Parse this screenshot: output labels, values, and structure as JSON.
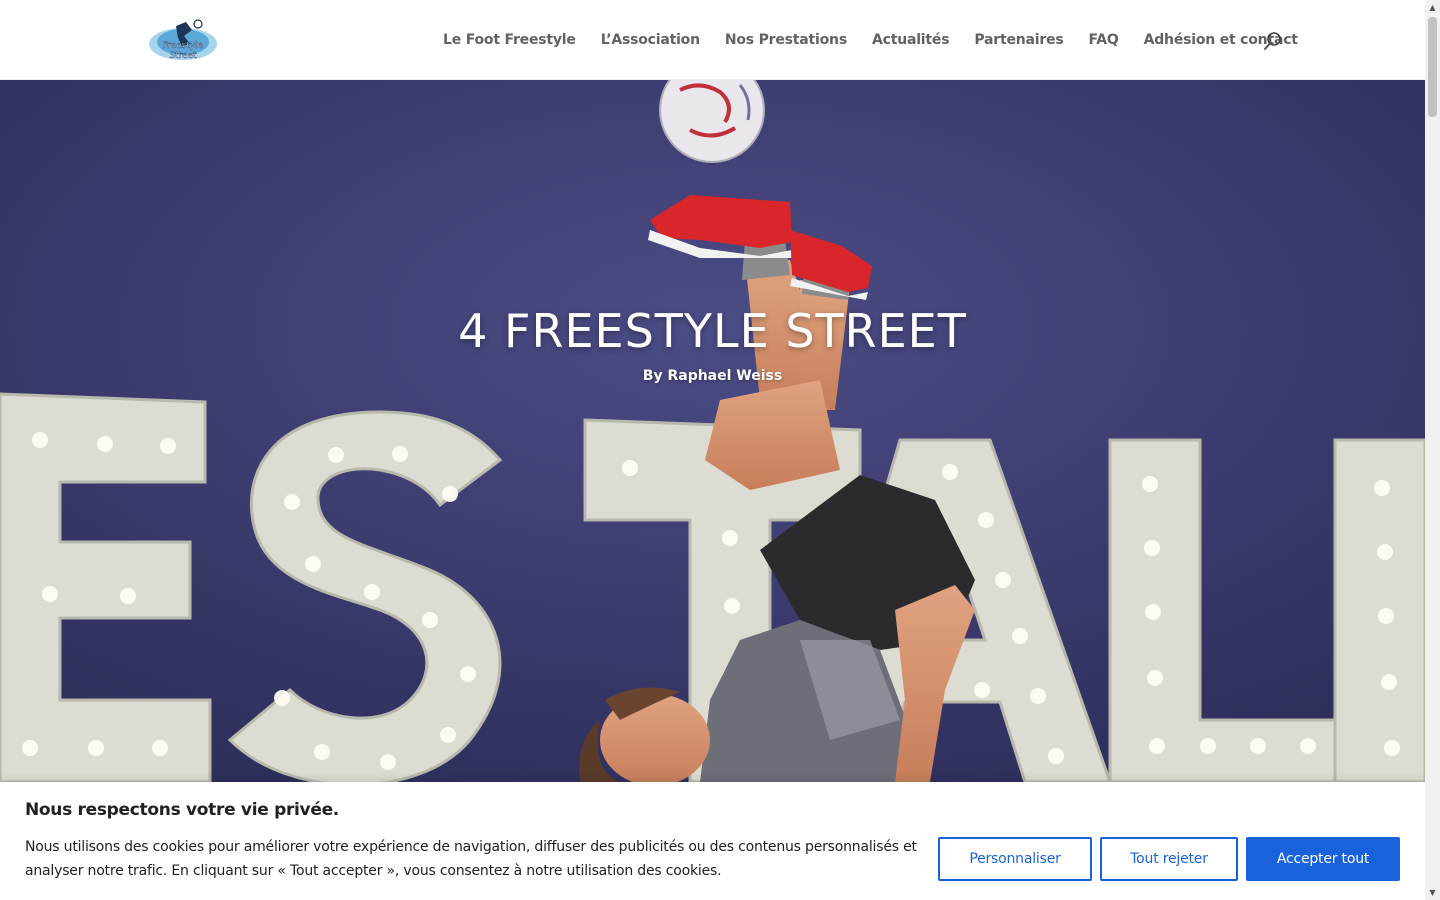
{
  "header": {
    "logo_text": "Freestyle Street",
    "nav": [
      {
        "label": "Le Foot Freestyle"
      },
      {
        "label": "L’Association"
      },
      {
        "label": "Nos Prestations"
      },
      {
        "label": "Actualités"
      },
      {
        "label": "Partenaires"
      },
      {
        "label": "FAQ"
      },
      {
        "label": "Adhésion et contact"
      }
    ],
    "search_icon": "search-icon"
  },
  "hero": {
    "title": "4 FREESTYLE STREET",
    "author": "By Raphael Weiss",
    "sign_letters": "ESTAL"
  },
  "cookie": {
    "title": "Nous respectons votre vie privée.",
    "text": "Nous utilisons des cookies pour améliorer votre expérience de navigation, diffuser des publicités ou des contenus personnalisés et analyser notre trafic. En cliquant sur « Tout accepter », vous consentez à notre utilisation des cookies.",
    "customize": "Personnaliser",
    "reject": "Tout rejeter",
    "accept": "Accepter tout"
  },
  "colors": {
    "accent": "#1863dc",
    "hero_bg": "#3b3b72",
    "shoe": "#d9262b"
  }
}
